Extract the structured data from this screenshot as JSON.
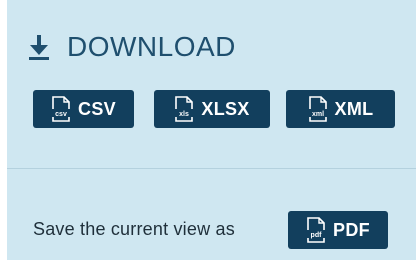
{
  "colors": {
    "panel_bg": "#cfe7f1",
    "button_bg": "#123f5d",
    "title": "#1f4f6e"
  },
  "header": {
    "icon": "download-icon",
    "title": "DOWNLOAD"
  },
  "buttons": [
    {
      "label": "CSV",
      "icon": "csv-file-icon",
      "icon_text": "csv"
    },
    {
      "label": "XLSX",
      "icon": "xls-file-icon",
      "icon_text": "xls"
    },
    {
      "label": "XML",
      "icon": "xml-file-icon",
      "icon_text": "xml"
    }
  ],
  "save_view": {
    "text": "Save the current view as",
    "button": {
      "label": "PDF",
      "icon": "pdf-file-icon",
      "icon_text": "pdf"
    }
  }
}
